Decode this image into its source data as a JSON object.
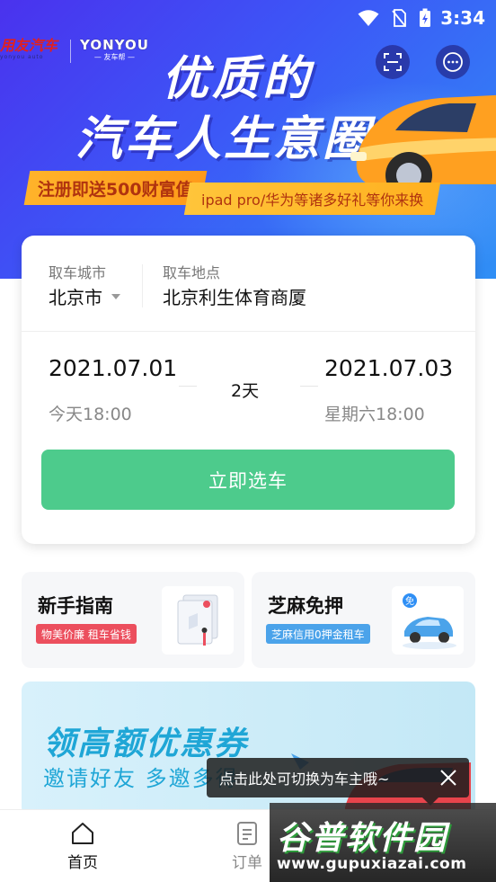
{
  "status_bar": {
    "time": "3:34",
    "icons": [
      "wifi-icon",
      "no-sim-icon",
      "battery-charging-icon"
    ]
  },
  "banner": {
    "logo_left": "用友汽车",
    "logo_left_sub": "yonyou auto",
    "logo_right": "YONYOU",
    "logo_right_sub": "— 友车帮 —",
    "headline_line1": "优质的",
    "headline_line2": "汽车人生意圈",
    "promo_left": "注册即送500财富值",
    "promo_right": "ipad pro/华为等诸多好礼等你来换",
    "buttons": [
      "scan-icon",
      "more-icon"
    ],
    "colors": {
      "accent": "#4a32ee",
      "promo": "#ffb32a",
      "promo_text": "#b0330f"
    }
  },
  "booking": {
    "city_label": "取车城市",
    "city_value": "北京市",
    "place_label": "取车地点",
    "place_value": "北京利生体育商厦",
    "start_date": "2021.07.01",
    "start_time": "今天18:00",
    "duration": "2天",
    "end_date": "2021.07.03",
    "end_time": "星期六18:00",
    "select_button": "立即选车",
    "button_color": "#4dcb8c"
  },
  "features": [
    {
      "title": "新手指南",
      "badge": "物美价廉 租车省钱",
      "badge_color": "#ec4f5e",
      "icon": "guide-book-icon"
    },
    {
      "title": "芝麻免押",
      "badge": "芝麻信用0押金租车",
      "badge_color": "#4ba3ea",
      "icon": "deposit-free-car-icon"
    }
  ],
  "coupon": {
    "title": "领高额优惠券",
    "subtitle": "邀请好友 多邀多得"
  },
  "tooltip": {
    "text": "点击此处可切换为车主哦~"
  },
  "bottom_nav": [
    {
      "label": "首页",
      "icon": "home-icon",
      "active": true
    },
    {
      "label": "订单",
      "icon": "order-icon",
      "active": false
    }
  ],
  "watermark": {
    "main": "谷普软件园",
    "url": "www.gupuxiazai.com"
  }
}
